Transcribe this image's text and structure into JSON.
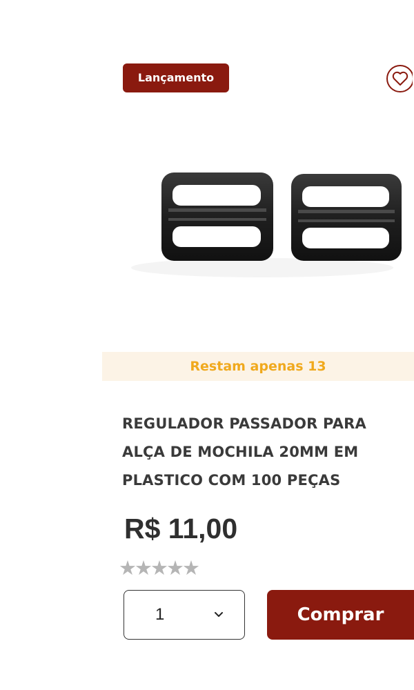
{
  "product": {
    "badge": "Lançamento",
    "stock_notice": "Restam apenas 13",
    "title_lines": [
      "REGULADOR PASSADOR PARA",
      "ALÇA DE MOCHILA 20MM EM",
      "PLASTICO COM 100 PEÇAS"
    ],
    "price": "R$ 11,00",
    "rating": {
      "stars": 5,
      "filled": 0,
      "text": "★★★★★"
    },
    "quantity": {
      "selected": "1"
    },
    "buy_label": "Comprar",
    "image_alt_icon": "plastic-slide-buckle-pair",
    "wishlist_icon": "heart-icon"
  },
  "colors": {
    "brand": "#8a1a0f",
    "stock_text": "#f0a91d",
    "stock_bg": "#fcf3e6",
    "star": "#b5b5b5",
    "title": "#3a3a3a"
  }
}
